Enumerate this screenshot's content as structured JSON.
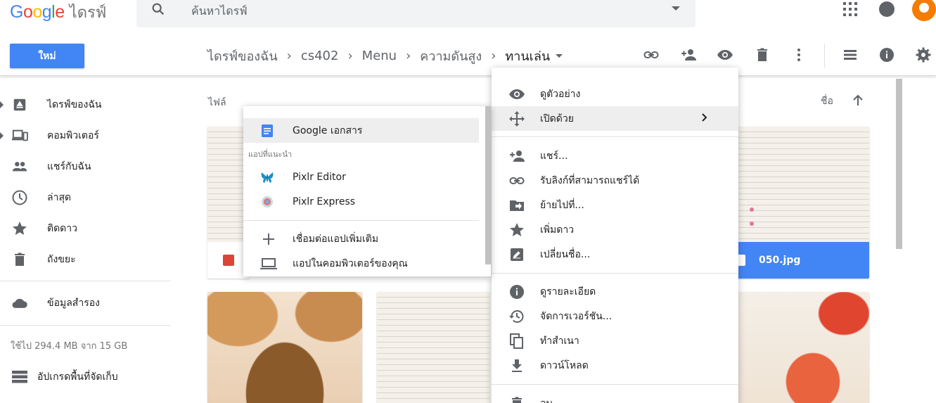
{
  "header": {
    "logo_text": "Google",
    "logo_colors": [
      "#4285f4",
      "#ea4335",
      "#fbbc05",
      "#4285f4",
      "#34a853",
      "#ea4335"
    ],
    "product_name": "ไดรฟ์",
    "search_placeholder": "ค้นหาไดรฟ์"
  },
  "toolbar": {
    "new_button": "ใหม่",
    "breadcrumb": [
      "ไดรฟ์ของฉัน",
      "cs402",
      "Menu",
      "ความดันสูง"
    ],
    "breadcrumb_current": "ทานเล่น",
    "separator": "›",
    "icons": [
      "link-icon",
      "add-person-icon",
      "eye-icon",
      "trash-icon",
      "more-vert-icon",
      "list-view-icon",
      "info-icon",
      "settings-icon"
    ]
  },
  "sidebar": {
    "items": [
      {
        "label": "ไดรฟ์ของฉัน",
        "icon": "drive-icon"
      },
      {
        "label": "คอมพิวเตอร์",
        "icon": "computer-icon"
      },
      {
        "label": "แชร์กับฉัน",
        "icon": "people-icon"
      },
      {
        "label": "ล่าสุด",
        "icon": "clock-icon"
      },
      {
        "label": "ติดดาว",
        "icon": "star-icon"
      },
      {
        "label": "ถังขยะ",
        "icon": "trash-icon"
      }
    ],
    "backup": "ข้อมูลสำรอง",
    "storage": "ใช้ไป 294.4 MB จาก 15 GB",
    "upgrade": "อัปเกรดพื้นที่จัดเก็บ"
  },
  "main": {
    "files_label": "ไฟล์",
    "sort_label": "ชื่อ",
    "selected_file": "050.jpg"
  },
  "open_with_menu": {
    "top_app": "Google เอกสาร",
    "suggested_heading": "แอปที่แนะนำ",
    "suggested": [
      "Pixlr Editor",
      "Pixlr Express"
    ],
    "connect_more": "เชื่อมต่อแอปเพิ่มเติม",
    "computer_apps": "แอปในคอมพิวเตอร์ของคุณ"
  },
  "context_menu": {
    "groups": [
      [
        {
          "label": "ดูตัวอย่าง",
          "icon": "eye-icon"
        },
        {
          "label": "เปิดด้วย",
          "icon": "move-arrows-icon",
          "submenu": true
        }
      ],
      [
        {
          "label": "แชร์...",
          "icon": "add-person-icon"
        },
        {
          "label": "รับลิงก์ที่สามารถแชร์ได้",
          "icon": "link-icon"
        },
        {
          "label": "ย้ายไปที่...",
          "icon": "move-to-folder-icon"
        },
        {
          "label": "เพิ่มดาว",
          "icon": "star-icon"
        },
        {
          "label": "เปลี่ยนชื่อ...",
          "icon": "rename-icon"
        }
      ],
      [
        {
          "label": "ดูรายละเอียด",
          "icon": "info-icon"
        },
        {
          "label": "จัดการเวอร์ชัน...",
          "icon": "history-icon"
        },
        {
          "label": "ทำสำเนา",
          "icon": "copy-icon"
        },
        {
          "label": "ดาวน์โหลด",
          "icon": "download-icon"
        }
      ],
      [
        {
          "label": "ลบ",
          "icon": "trash-icon"
        }
      ]
    ]
  },
  "colors": {
    "accent": "#4285f4",
    "icon_gray": "#5f6368",
    "image_badge": "#db4437",
    "avatar": "#f57c00"
  }
}
